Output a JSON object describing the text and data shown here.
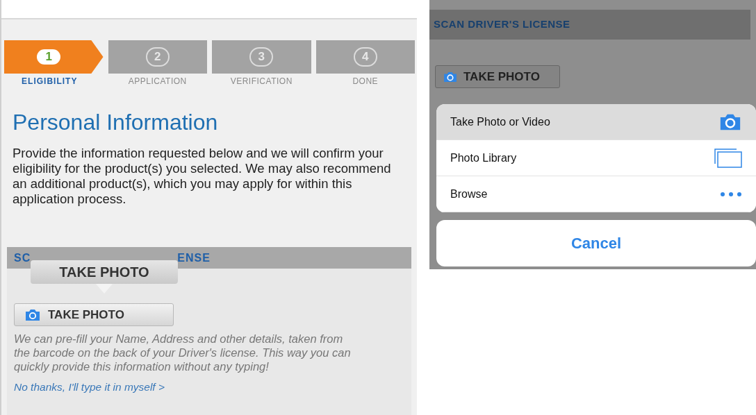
{
  "left_screen": {
    "steps": [
      {
        "number": "1",
        "label": "ELIGIBILITY",
        "selected": true
      },
      {
        "number": "2",
        "label": "APPLICATION",
        "selected": false
      },
      {
        "number": "3",
        "label": "VERIFICATION",
        "selected": false
      },
      {
        "number": "4",
        "label": "DONE",
        "selected": false
      }
    ],
    "title": "Personal Information",
    "intro": "Provide the information requested below and we will confirm your eligibility for the product(s) you selected. We may also recommend an additional product(s), which you may apply for within this application process.",
    "section": {
      "header_parts": [
        "SC",
        "ENSE"
      ],
      "tooltip": "TAKE PHOTO",
      "button": "TAKE PHOTO",
      "description": "We can pre-fill your Name, Address and other details, taken from the barcode on the back of your Driver's license. This way you can quickly provide this information without any typing!",
      "link": "No thanks, I'll type it in myself >"
    }
  },
  "right_screen": {
    "section_header": "SCAN DRIVER'S LICENSE",
    "button": "TAKE PHOTO",
    "action_sheet": {
      "items": [
        {
          "label": "Take Photo or Video",
          "kind": "camera",
          "selected": true
        },
        {
          "label": "Photo Library",
          "kind": "library",
          "selected": false
        },
        {
          "label": "Browse",
          "kind": "more",
          "selected": false
        }
      ],
      "cancel": "Cancel"
    }
  }
}
